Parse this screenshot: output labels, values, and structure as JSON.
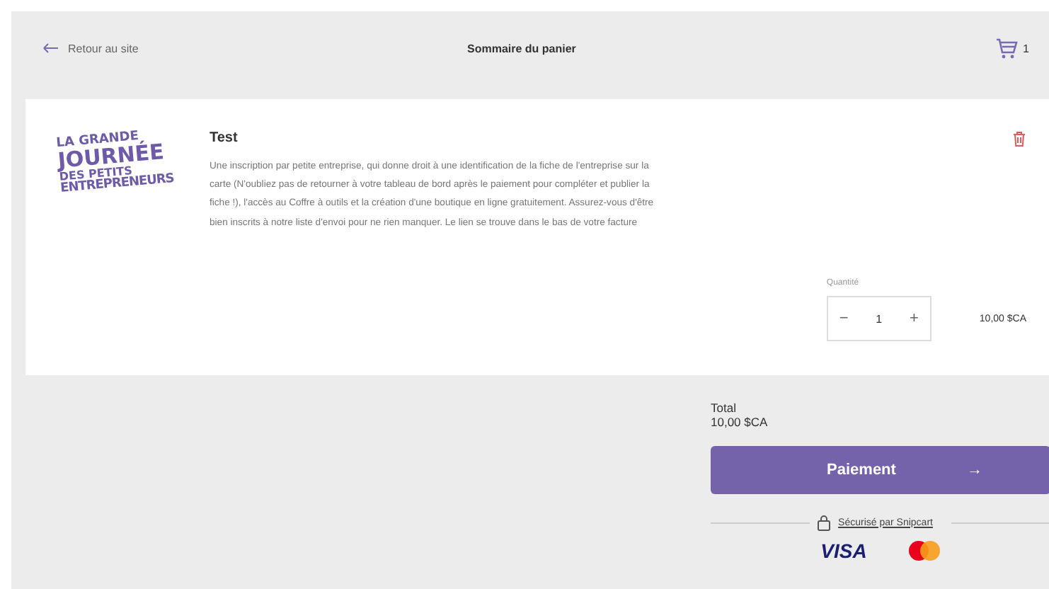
{
  "header": {
    "back_link": "Retour au site",
    "title": "Sommaire du panier",
    "cart_count": "1"
  },
  "item": {
    "logo_lines": [
      "LA GRANDE",
      "JOURNÉE",
      "DES PETITS",
      "ENTREPRENEURS"
    ],
    "name": "Test",
    "description": "Une inscription par petite entreprise, qui donne droit à une identification de la fiche de l'entreprise sur la carte (N'oubliez pas de retourner à votre tableau de bord après le paiement pour compléter et publier la fiche !), l'accès au Coffre à outils et la création d'une boutique en ligne gratuitement. Assurez-vous d'être bien inscrits à notre liste d'envoi pour ne rien manquer. Le lien se trouve dans le bas de votre facture",
    "quantity_label": "Quantité",
    "quantity": "1",
    "decrement": "−",
    "increment": "+",
    "price": "10,00 $CA"
  },
  "summary": {
    "total_label": "Total",
    "total": "10,00 $CA",
    "pay_button": "Paiement",
    "pay_arrow": "→",
    "secured": "Sécurisé par Snipcart",
    "card_brand": "VISA"
  }
}
